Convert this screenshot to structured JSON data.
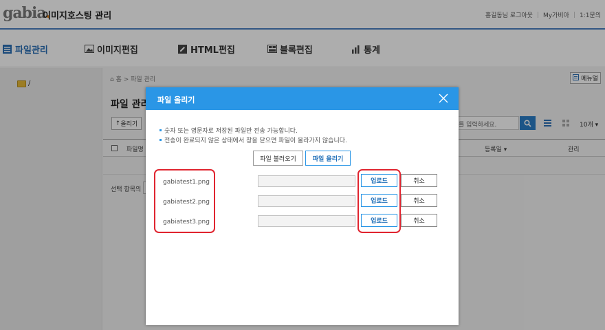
{
  "header": {
    "logo_text": "gabia",
    "logo_dot": ".",
    "app_title": "이미지호스팅 관리",
    "user_label": "홍길동님 로그아웃",
    "my_gabia": "My가비아",
    "inquiry": "1:1문의"
  },
  "nav": {
    "items": [
      {
        "label": "파일관리",
        "icon": "list-icon",
        "active": true
      },
      {
        "label": "이미지편집",
        "icon": "image-icon",
        "active": false
      },
      {
        "label": "HTML편집",
        "icon": "pencil-icon",
        "active": false
      },
      {
        "label": "블록편집",
        "icon": "block-icon",
        "active": false
      },
      {
        "label": "통계",
        "icon": "bar-chart-icon",
        "active": false
      }
    ]
  },
  "sidebar": {
    "folder_label": "/"
  },
  "content": {
    "breadcrumb": "홈 > 파일 관리",
    "menu_label": "메뉴얼",
    "title": "파일 관리",
    "upload_mini": "올리기",
    "search_placeholder": "를 입력하세요.",
    "per_page": "10개",
    "columns": {
      "file_name": "파일명",
      "date": "등록일",
      "manage": "관리"
    },
    "selection_label": "선택 항목의"
  },
  "modal": {
    "title": "파일 올리기",
    "notices": [
      "숫자 또는 영문자로 저장된 파일만 전송 가능합니다.",
      "전송이 완료되지 않은 상태에서 창을 닫으면 파일이 올라가지 않습니다."
    ],
    "load_files_label": "파일 불러오기",
    "upload_files_label": "파일 올리기",
    "files": [
      {
        "name": "gabiatest1.png",
        "upload_label": "업로드",
        "cancel_label": "취소",
        "progress": 0
      },
      {
        "name": "gabiatest2.png",
        "upload_label": "업로드",
        "cancel_label": "취소",
        "progress": 0
      },
      {
        "name": "gabiatest3.png",
        "upload_label": "업로드",
        "cancel_label": "취소",
        "progress": 0
      }
    ]
  },
  "colors": {
    "accent": "#2a96e6",
    "highlight": "#e0242f",
    "nav_active": "#2a6fb5"
  }
}
